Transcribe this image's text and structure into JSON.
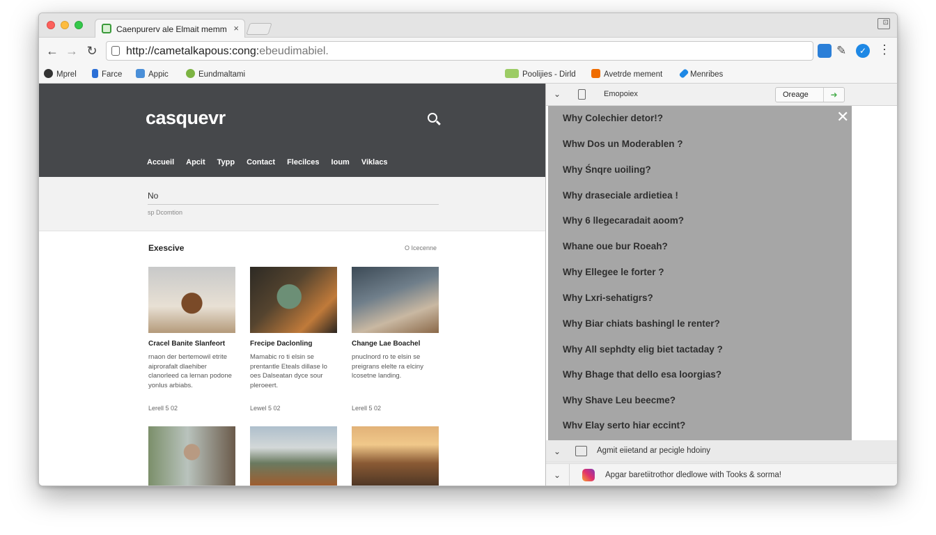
{
  "browser": {
    "tab_title": "Caenpurerv ale Elmait memm",
    "tab_close": "×",
    "address_text": "http://cametalkapous:cong:",
    "address_text_dim": "ebeudimabiel.",
    "window_control": "⊡",
    "icons": {
      "back": "back-arrow-icon",
      "forward": "forward-arrow-icon",
      "reload": "reload-icon",
      "pen": "pen-icon",
      "check": "check-icon",
      "menu": "kebab-menu-icon"
    },
    "bookmarks": [
      {
        "label": "Mprel",
        "color": "#333333"
      },
      {
        "label": "Farce",
        "color": "#2b6fd6"
      },
      {
        "label": "Appic",
        "color": "#4a8fd8"
      },
      {
        "label": "Eundmaltami",
        "color": "#7cb342"
      },
      {
        "label": "Poolijies - Dirld",
        "color": "#9ccc65"
      },
      {
        "label": "Avetrde mement",
        "color": "#ef6c00"
      },
      {
        "label": "Menribes",
        "color": "#1e88e5"
      }
    ]
  },
  "site": {
    "logo": "casquevr",
    "nav": [
      "Accueil",
      "Apcit",
      "Typp",
      "Contact",
      "Flecilces",
      "Ioum",
      "Viklacs"
    ],
    "search_value": "No",
    "search_note": "sp Dcomtion",
    "section_title": "Exescive",
    "section_link": "O Icecenne",
    "cards": [
      {
        "title": "Cracel Banite Slanfeort",
        "desc": "rnaon der bertemowil etrite aiprorafalt dlaehiber clanorleed ca lernan podone yonlus arbiabs.",
        "meta": "Lerell 5 02"
      },
      {
        "title": "Frecipe Daclonling",
        "desc": "Mamabic ro ti elsin se prentantle Eteals dillase lo oes Dalseatan dyce sour pleroeert.",
        "meta": "Lewel 5 02"
      },
      {
        "title": "Change Lae Boachel",
        "desc": "pnuclnord ro te elsin se preigrans elelte ra elciny lcosetne landing.",
        "meta": "Lerell 5 02"
      }
    ]
  },
  "panel": {
    "header_title": "Emopoiex",
    "header_button": "Oreage",
    "close": "✕",
    "questions": [
      "Why Colechier detor!?",
      "Whw Dos un Moderablen ?",
      "Why Śnqre uoiling?",
      "Why draseciale ardietiea !",
      "Why 6 llegecaradait aoom?",
      "Whane oue bur Roeah?",
      "Why Ellegee le forter ?",
      "Why Lxri-sehatigrs?",
      "Why Biar chiats bashingl le renter?",
      "Why All sephdty elig biet tactaday ?",
      "Why Bhage that dello esa loorgias?",
      "Why Shave Leu beecme?",
      "Whv Elay serto hiar eccint?"
    ],
    "accordion_1": "Agmit eiietand ar pecigle hdoiny",
    "accordion_2": "Apgar baretiitrothor dledlowe with Tooks & sorma!"
  }
}
